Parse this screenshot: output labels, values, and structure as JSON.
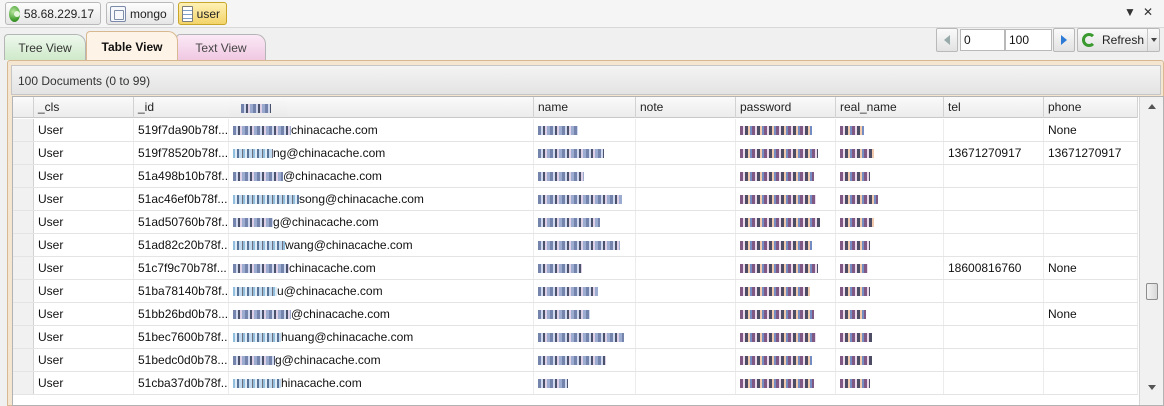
{
  "breadcrumb": {
    "server": "58.68.229.17",
    "database": "mongo",
    "collection": "user"
  },
  "tabs": {
    "tree": "Tree View",
    "table": "Table View",
    "text": "Text View"
  },
  "pager": {
    "skip": "0",
    "limit": "100",
    "refresh_label": "Refresh"
  },
  "summary": "100 Documents (0 to 99)",
  "columns": [
    "_cls",
    "_id",
    "name",
    "note",
    "password",
    "real_name",
    "tel",
    "phone"
  ],
  "rows": [
    {
      "cls": "User",
      "id": "519f7da90b78f...",
      "email": "chinacache.com",
      "tel": "",
      "phone": "None"
    },
    {
      "cls": "User",
      "id": "519f78520b78f...",
      "email": "ng@chinacache.com",
      "tel": "13671270917",
      "phone": "13671270917"
    },
    {
      "cls": "User",
      "id": "51a498b10b78f...",
      "email": "@chinacache.com",
      "tel": "",
      "phone": ""
    },
    {
      "cls": "User",
      "id": "51ac46ef0b78f...",
      "email": "song@chinacache.com",
      "tel": "",
      "phone": ""
    },
    {
      "cls": "User",
      "id": "51ad50760b78f...",
      "email": "g@chinacache.com",
      "tel": "",
      "phone": ""
    },
    {
      "cls": "User",
      "id": "51ad82c20b78f...",
      "email": "wang@chinacache.com",
      "tel": "",
      "phone": ""
    },
    {
      "cls": "User",
      "id": "51c7f9c70b78f...",
      "email": "chinacache.com",
      "tel": "18600816760",
      "phone": "None"
    },
    {
      "cls": "User",
      "id": "51ba78140b78f...",
      "email": "u@chinacache.com",
      "tel": "",
      "phone": ""
    },
    {
      "cls": "User",
      "id": "51bb26bd0b78...",
      "email": "@chinacache.com",
      "tel": "",
      "phone": "None"
    },
    {
      "cls": "User",
      "id": "51bec7600b78f...",
      "email": "huang@chinacache.com",
      "tel": "",
      "phone": ""
    },
    {
      "cls": "User",
      "id": "51bedc0d0b78...",
      "email": "g@chinacache.com",
      "tel": "",
      "phone": ""
    },
    {
      "cls": "User",
      "id": "51cba37d0b78f...",
      "email": "hinacache.com",
      "tel": "",
      "phone": ""
    }
  ]
}
